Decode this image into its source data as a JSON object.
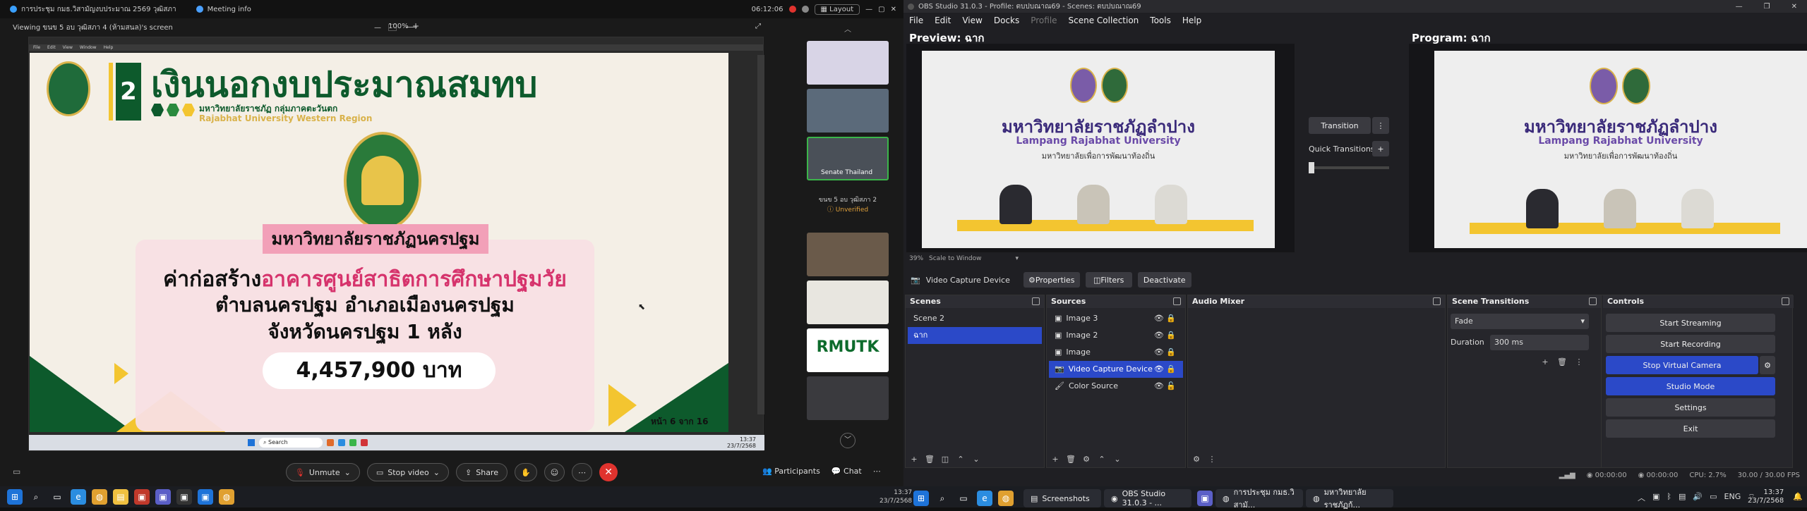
{
  "webex": {
    "tabs": [
      {
        "label": "การประชุม กมธ.วิสามัญงบประมาณ 2569 วุฒิสภา",
        "icon": "webex-icon"
      },
      {
        "label": "Meeting info",
        "icon": "info-icon"
      }
    ],
    "clock": "06:12:06",
    "layout_label": "Layout",
    "viewing_label": "Viewing ขนข 5 อบ วุฒิสภา 4 (ห้ามสนล)'s screen",
    "zoom": "100%",
    "thumbnails": [
      {
        "label": ""
      },
      {
        "label": ""
      },
      {
        "label": "Senate Thailand"
      },
      {
        "label": "ขนข 5 อบ วุฒิสภา 2",
        "sub": "Unverified"
      },
      {
        "label": ""
      },
      {
        "label": ""
      },
      {
        "label": "RMUTK"
      },
      {
        "label": ""
      }
    ],
    "controls": {
      "unmute": "Unmute",
      "stop_video": "Stop video",
      "share": "Share",
      "participants": "Participants",
      "chat": "Chat"
    },
    "inner_menu": [
      "File",
      "Edit",
      "View",
      "Window",
      "Help"
    ],
    "inner_search": "Search",
    "inner_clock": "13:37",
    "inner_date": "23/7/2568"
  },
  "slide": {
    "number": "2",
    "heading": "เงินนอกงบประมาณสมทบ",
    "org_th": "มหาวิทยาลัยราชภัฏ กลุ่มภาคตะวันตก",
    "org_en": "Rajabhat University Western Region",
    "university": "มหาวิทยาลัยราชภัฏนครปฐม",
    "line1_prefix": "ค่าก่อสร้าง",
    "line1_highlight": "อาคารศูนย์สาธิตการศึกษาปฐมวัย",
    "line2": "ตำบลนครปฐม อำเภอเมืองนครปฐม",
    "line3": "จังหวัดนครปฐม 1 หลัง",
    "amount": "4,457,900 บาท",
    "page": "หน้า 6 จาก 16"
  },
  "obs": {
    "title": "OBS Studio 31.0.3 - Profile: ตบปบณาณ69 - Scenes: ตบปบณาณ69",
    "menu": [
      "File",
      "Edit",
      "View",
      "Docks",
      "Profile",
      "Scene Collection",
      "Tools",
      "Help"
    ],
    "preview_label": "Preview: ฉาก",
    "program_label": "Program: ฉาก",
    "transition_btn": "Transition",
    "quick_transitions": "Quick Transitions",
    "zoom_text": "39%",
    "scale_text": "Scale to Window",
    "source_bar": {
      "name": "Video Capture Device",
      "properties": "Properties",
      "filters": "Filters",
      "deactivate": "Deactivate"
    },
    "scene_banner": {
      "th": "มหาวิทยาลัยราชภัฏลำปาง",
      "en": "Lampang Rajabhat University",
      "tag": "มหาวิทยาลัยเพื่อการพัฒนาท้องถิ่น"
    },
    "docks": {
      "scenes": {
        "title": "Scenes",
        "items": [
          "Scene 2",
          "ฉาก"
        ]
      },
      "sources": {
        "title": "Sources",
        "items": [
          "Image 3",
          "Image 2",
          "Image",
          "Video Capture Device",
          "Color Source"
        ]
      },
      "audio": {
        "title": "Audio Mixer"
      },
      "transitions": {
        "title": "Scene Transitions",
        "selected": "Fade",
        "duration_label": "Duration",
        "duration_value": "300 ms"
      },
      "controls": {
        "title": "Controls",
        "buttons": [
          "Start Streaming",
          "Start Recording",
          "Stop Virtual Camera",
          "Studio Mode",
          "Settings",
          "Exit"
        ]
      }
    },
    "status": {
      "time1": "00:00:00",
      "time2": "00:00:00",
      "cpu": "CPU: 2.7%",
      "fps": "30.00 / 30.00 FPS"
    }
  },
  "taskbar": {
    "apps": [
      {
        "label": "Screenshots",
        "icon": "folder-icon"
      },
      {
        "label": "OBS Studio 31.0.3 - ...",
        "icon": "obs-icon"
      },
      {
        "label": "การประชุม กมธ.วิสามั...",
        "icon": "webex-icon"
      },
      {
        "label": "มหาวิทยาลัยราชภัฏก้...",
        "icon": "chrome-icon"
      }
    ],
    "lang": "ENG",
    "time": "13:37",
    "date": "23/7/2568",
    "left_time": "13:37",
    "left_date": "23/7/2568"
  },
  "colors": {
    "obs_blue": "#2b49c8",
    "red": "#e0332e",
    "green": "#0d5a2c",
    "pink": "#f2a0b8"
  }
}
